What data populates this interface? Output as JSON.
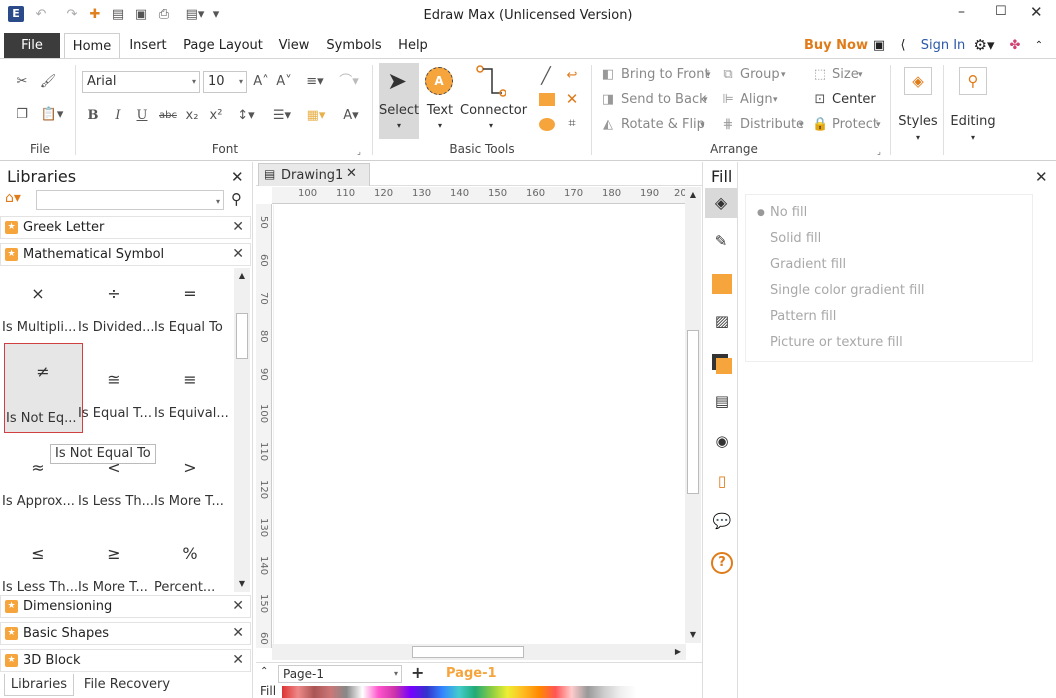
{
  "window": {
    "title": "Edraw Max (Unlicensed Version)"
  },
  "menu": {
    "file": "File",
    "tabs": [
      "Home",
      "Insert",
      "Page Layout",
      "View",
      "Symbols",
      "Help"
    ],
    "buy_now": "Buy Now",
    "sign_in": "Sign In"
  },
  "ribbon": {
    "groups": {
      "file": "File",
      "font": "Font",
      "basic_tools": "Basic Tools",
      "arrange": "Arrange"
    },
    "font": {
      "name": "Arial",
      "size": "10"
    },
    "tools": {
      "select": "Select",
      "text": "Text",
      "connector": "Connector"
    },
    "arrange": {
      "bring_to_front": "Bring to Front",
      "send_to_back": "Send to Back",
      "rotate_flip": "Rotate & Flip",
      "group": "Group",
      "align": "Align",
      "distribute": "Distribute",
      "size": "Size",
      "center": "Center",
      "protect": "Protect"
    },
    "styles": "Styles",
    "editing": "Editing",
    "text_glyph": "A"
  },
  "libraries": {
    "title": "Libraries",
    "search_value": "",
    "sections": [
      "Greek Letter",
      "Mathematical Symbol"
    ],
    "symbols": [
      {
        "glyph": "×",
        "label": "Is Multipli..."
      },
      {
        "glyph": "÷",
        "label": "Is Divided..."
      },
      {
        "glyph": "=",
        "label": "Is Equal To"
      },
      {
        "glyph": "≠",
        "label": "Is Not Eq..."
      },
      {
        "glyph": "≅",
        "label": "Is Equal T..."
      },
      {
        "glyph": "≡",
        "label": "Is Equival..."
      },
      {
        "glyph": "≈",
        "label": "Is Approx..."
      },
      {
        "glyph": "<",
        "label": "Is Less Th..."
      },
      {
        "glyph": ">",
        "label": "Is More T..."
      },
      {
        "glyph": "≤",
        "label": "Is Less Th..."
      },
      {
        "glyph": "≥",
        "label": "Is More T..."
      },
      {
        "glyph": "%",
        "label": "Percent..."
      }
    ],
    "tooltip": "Is Not Equal To",
    "bottom_sections": [
      "Dimensioning",
      "Basic Shapes",
      "3D Block"
    ],
    "bottom_tabs": [
      "Libraries",
      "File Recovery"
    ]
  },
  "document": {
    "tab": "Drawing1",
    "h_ruler": [
      "100",
      "110",
      "120",
      "130",
      "140",
      "150",
      "160",
      "170",
      "180",
      "190",
      "20"
    ],
    "v_ruler": [
      "50",
      "60",
      "70",
      "80",
      "90",
      "100",
      "110",
      "120",
      "130",
      "140",
      "150",
      "60"
    ],
    "page_selector": "Page-1",
    "page_tab": "Page-1",
    "fill_label": "Fill"
  },
  "fill_panel": {
    "title": "Fill",
    "options": [
      "No fill",
      "Solid fill",
      "Gradient fill",
      "Single color gradient fill",
      "Pattern fill",
      "Picture or texture fill"
    ]
  },
  "colors": {
    "accent": "#f6a43c",
    "select_bg": "#d9d9d9",
    "brand_red": "#c0392b",
    "sign_in": "#2b5aa8"
  },
  "icons": [
    "app-logo-icon",
    "undo-icon",
    "redo-icon",
    "new-icon",
    "open-icon",
    "save-icon",
    "print-icon",
    "export-icon",
    "minimize-icon",
    "maximize-icon",
    "close-icon",
    "share-icon",
    "gear-icon",
    "search-icon",
    "home-icon"
  ]
}
